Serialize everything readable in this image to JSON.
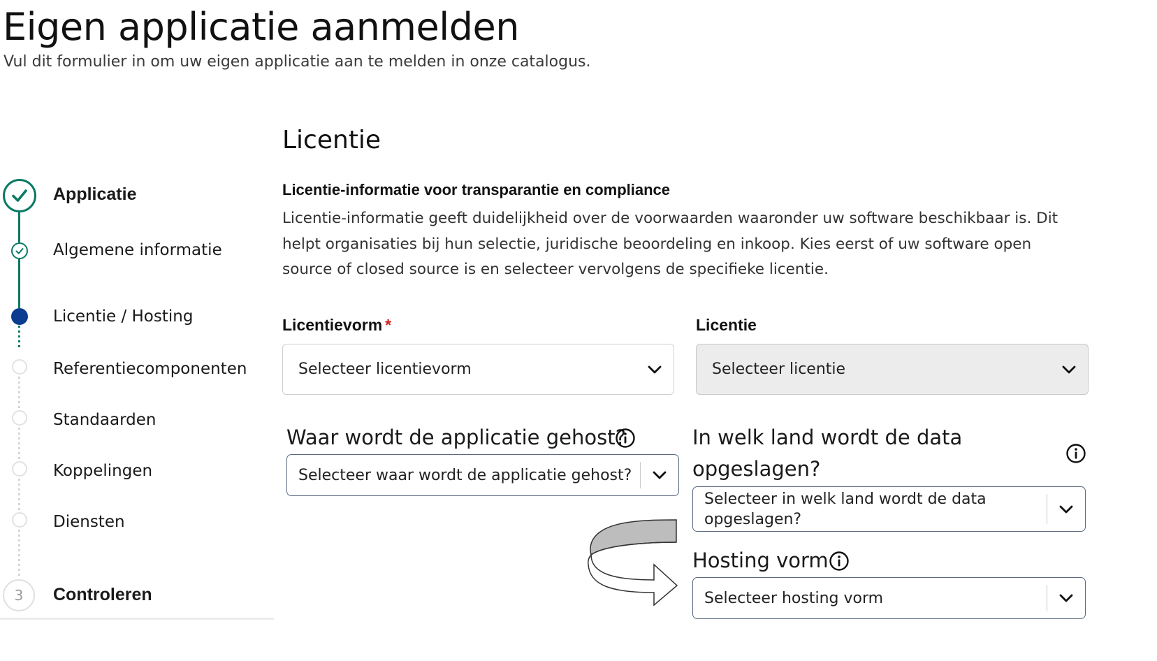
{
  "page": {
    "title": "Eigen applicatie aanmelden",
    "subtitle": "Vul dit formulier in om uw eigen applicatie aan te melden in onze catalogus."
  },
  "stepper": {
    "steps": [
      {
        "label": "Applicatie",
        "state": "completed-section"
      },
      {
        "label": "Algemene informatie",
        "state": "completed"
      },
      {
        "label": "Licentie / Hosting",
        "state": "active"
      },
      {
        "label": "Referentiecomponenten",
        "state": "pending"
      },
      {
        "label": "Standaarden",
        "state": "pending"
      },
      {
        "label": "Koppelingen",
        "state": "pending"
      },
      {
        "label": "Diensten",
        "state": "pending"
      },
      {
        "label": "Controleren",
        "state": "section",
        "number": "3"
      }
    ],
    "colors": {
      "completed": "#0b7a65",
      "active": "#0a3d8f",
      "pending": "#e2e2e2"
    }
  },
  "section": {
    "title": "Licentie",
    "intro_heading": "Licentie-informatie voor transparantie en compliance",
    "intro_text": "Licentie-informatie geeft duidelijkheid over de voorwaarden waaronder uw software beschikbaar is. Dit helpt organisaties bij hun selectie, juridische beoordeling en inkoop. Kies eerst of uw software open source of closed source is en selecteer vervolgens de specifieke licentie."
  },
  "fields": {
    "licentievorm": {
      "label": "Licentievorm",
      "required_marker": "*",
      "placeholder": "Selecteer licentievorm",
      "icon": "chevron-down-icon"
    },
    "licentie": {
      "label": "Licentie",
      "placeholder": "Selecteer licentie",
      "disabled": true,
      "icon": "chevron-down-icon"
    },
    "hosting": {
      "label": "Waar wordt de applicatie gehost?",
      "placeholder": "Selecteer waar wordt de applicatie gehost?",
      "icon": "info-icon"
    },
    "data_land": {
      "label": "In welk land wordt de data opgeslagen?",
      "placeholder": "Selecteer in welk land wordt de data opgeslagen?",
      "icon": "info-icon"
    },
    "hosting_vorm": {
      "label": "Hosting vorm",
      "placeholder": "Selecteer hosting vorm",
      "icon": "info-icon"
    }
  },
  "annotation": {
    "icon": "curved-arrow-icon"
  }
}
